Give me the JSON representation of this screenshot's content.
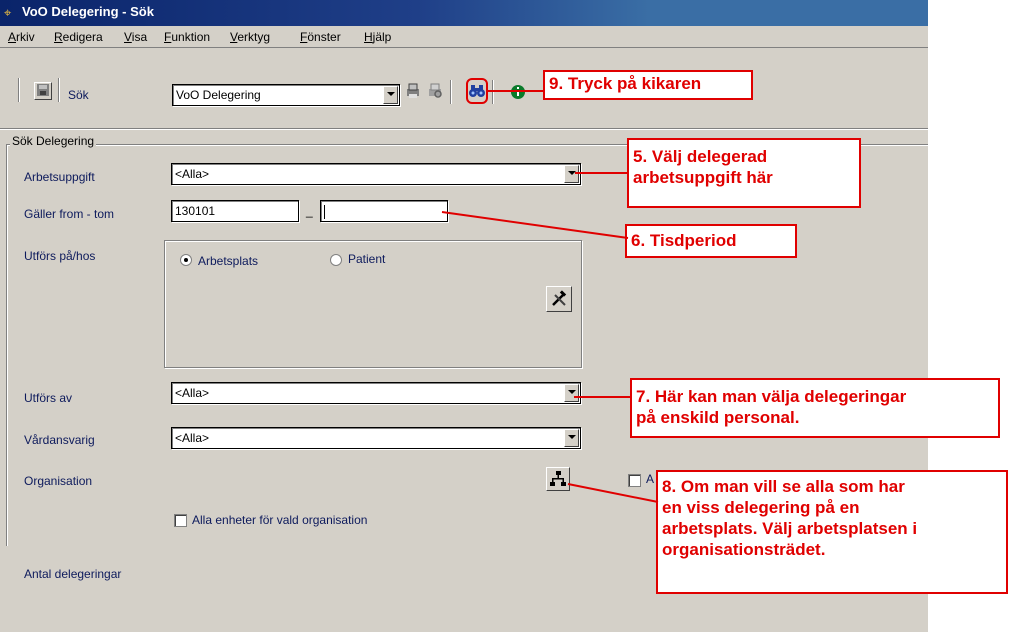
{
  "window": {
    "title": "VoO Delegering - Sök"
  },
  "menu": [
    "Arkiv",
    "Redigera",
    "Visa",
    "Funktion",
    "Verktyg",
    "Fönster",
    "Hjälp"
  ],
  "toolbar": {
    "search_label": "Sök",
    "module_select_value": "VoO Delegering"
  },
  "form": {
    "group_title": "Sök Delegering",
    "arbetsuppgift_label": "Arbetsuppgift",
    "arbetsuppgift_value": "<Alla>",
    "period_label": "Gäller from - tom",
    "period_from": "130101",
    "period_to": "",
    "period_dash": "_",
    "utfors_pa_label": "Utförs på/hos",
    "radio_arbetsplats": "Arbetsplats",
    "radio_patient": "Patient",
    "utfors_av_label": "Utförs av",
    "utfors_av_value": "<Alla>",
    "vardansvarig_label": "Vårdansvarig",
    "vardansvarig_value": "<Alla>",
    "organisation_label": "Organisation",
    "alla_enheter_label": "Alla enheter för vald organisation",
    "partial_checkbox_label": "A"
  },
  "footer": {
    "antal_label": "Antal delegeringar"
  },
  "callouts": {
    "c9": "9. Tryck på kikaren",
    "c5_line1": "5. Välj delegerad",
    "c5_line2": "arbetsuppgift här",
    "c6": "6. Tisdperiod",
    "c7_line1": "7. Här kan man välja delegeringar",
    "c7_line2": "på enskild personal.",
    "c8_line1": "8. Om man vill se alla som har",
    "c8_line2": "en viss delegering på en",
    "c8_line3": "arbetsplats. Välj arbetsplatsen i",
    "c8_line4": "organisationsträdet."
  },
  "colors": {
    "title_bar": "#0a246a",
    "window_bg": "#d4d0c8",
    "label_text": "#0d1a5c",
    "callout_red": "#e00000"
  },
  "icons": [
    "binoculars-icon",
    "save-icon",
    "print-icon",
    "print-preview-icon",
    "info-icon",
    "tools-icon",
    "org-tree-icon"
  ]
}
